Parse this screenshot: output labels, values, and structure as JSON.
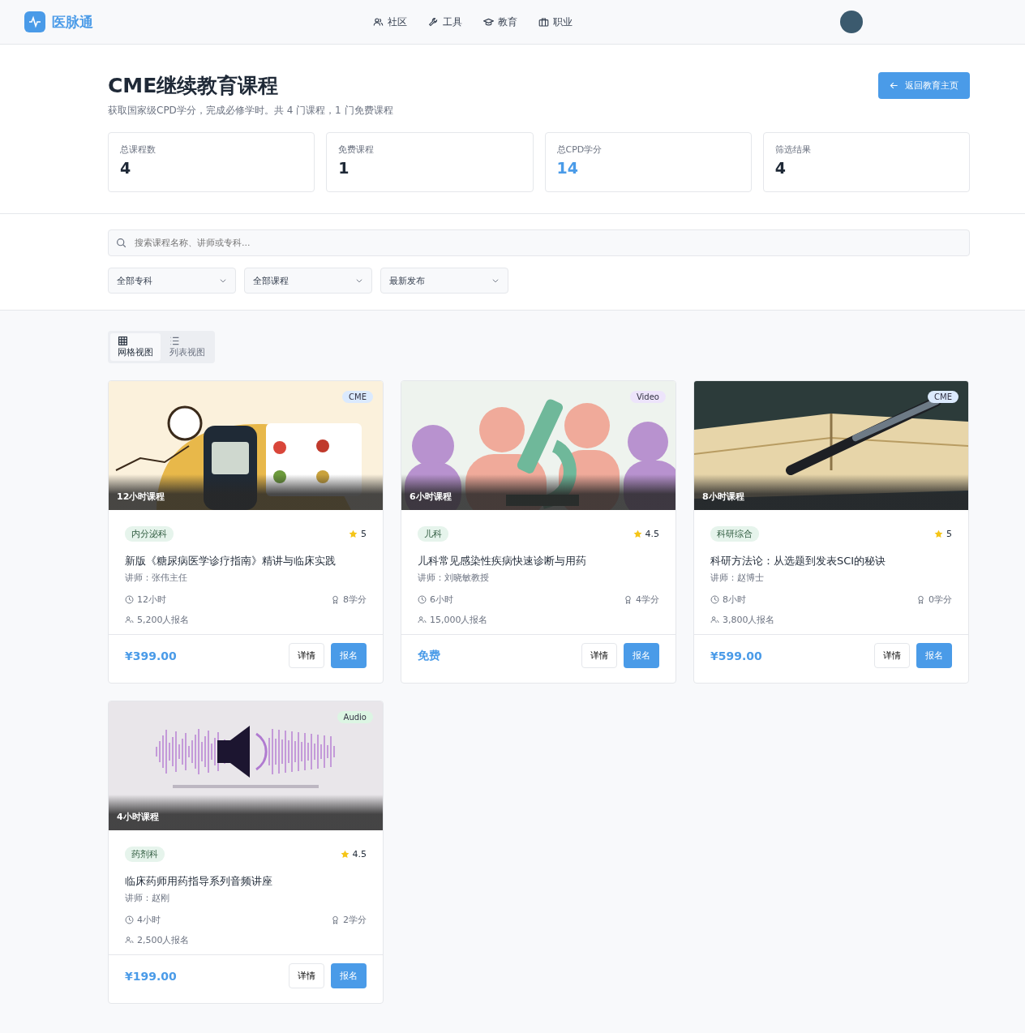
{
  "brand": {
    "name": "医脉通"
  },
  "nav": [
    {
      "label": "社区"
    },
    {
      "label": "工具"
    },
    {
      "label": "教育"
    },
    {
      "label": "职业"
    }
  ],
  "header": {
    "title": "CME继续教育课程",
    "subtitle": "获取国家级CPD学分，完成必修学时。共 4 门课程，1 门免费课程",
    "back_button": "返回教育主页"
  },
  "stats": [
    {
      "label": "总课程数",
      "value": "4",
      "accent": false
    },
    {
      "label": "免费课程",
      "value": "1",
      "accent": false
    },
    {
      "label": "总CPD学分",
      "value": "14",
      "accent": true
    },
    {
      "label": "筛选结果",
      "value": "4",
      "accent": false
    }
  ],
  "search": {
    "placeholder": "搜索课程名称、讲师或专科..."
  },
  "filters": [
    "全部专科",
    "全部课程",
    "最新发布"
  ],
  "view_toggle": [
    {
      "label": "网格视图",
      "selected": true
    },
    {
      "label": "列表视图",
      "selected": false
    }
  ],
  "courses": [
    {
      "kind": "picture",
      "badge": "CME",
      "color": "#dbeafe",
      "duration_overlay": "12小时课程",
      "specialty": "内分泌科",
      "rating": "5",
      "title": "新版《糖尿病医学诊疗指南》精讲与临床实践",
      "lecturer": "讲师：张伟主任",
      "hours": "12小时",
      "credits": "8学分",
      "enrolled": "5,200人报名",
      "price": "¥399.00",
      "details_button": "详情",
      "enroll_button": "报名"
    },
    {
      "kind": "picture",
      "badge": "Video",
      "color": "#ede4fb",
      "duration_overlay": "6小时课程",
      "specialty": "儿科",
      "rating": "4.5",
      "title": "儿科常见感染性疾病快速诊断与用药",
      "lecturer": "讲师：刘晓敏教授",
      "hours": "6小时",
      "credits": "4学分",
      "enrolled": "15,000人报名",
      "price": "免费",
      "details_button": "详情",
      "enroll_button": "报名"
    },
    {
      "kind": "picture",
      "badge": "CME",
      "color": "#dbeafe",
      "duration_overlay": "8小时课程",
      "specialty": "科研综合",
      "rating": "5",
      "title": "科研方法论：从选题到发表SCI的秘诀",
      "lecturer": "讲师：赵博士",
      "hours": "8小时",
      "credits": "0学分",
      "enrolled": "3,800人报名",
      "price": "¥599.00",
      "details_button": "详情",
      "enroll_button": "报名"
    },
    {
      "kind": "picture",
      "badge": "Audio",
      "color": "#dcf5e3",
      "duration_overlay": "4小时课程",
      "specialty": "药剂科",
      "rating": "4.5",
      "title": "临床药师用药指导系列音频讲座",
      "lecturer": "讲师：赵刚",
      "hours": "4小时",
      "credits": "2学分",
      "enrolled": "2,500人报名",
      "price": "¥199.00",
      "details_button": "详情",
      "enroll_button": "报名"
    }
  ]
}
